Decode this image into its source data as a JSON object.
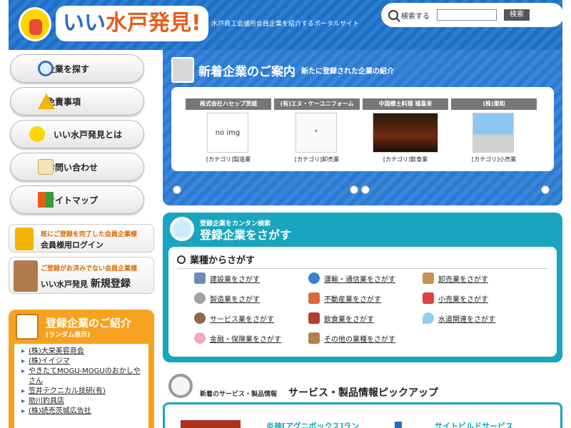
{
  "header": {
    "logo_main": "いい",
    "logo_accent": "水戸",
    "logo_end": "発見!",
    "tagline": "水戸商工会議所会員企業を紹介するポータルサイト",
    "search_label": "検索する",
    "search_value": "",
    "search_button": "検索"
  },
  "nav": {
    "items": [
      {
        "label": "企業を探す",
        "icon": "search-icon"
      },
      {
        "label": "免責事項",
        "icon": "warning-icon"
      },
      {
        "label": "いい水戸発見とは",
        "icon": "mascot-icon"
      },
      {
        "label": "お問い合わせ",
        "icon": "mail-icon"
      },
      {
        "label": "サイトマップ",
        "icon": "sitemap-icon"
      }
    ]
  },
  "member": {
    "login_small": "既にご登録を完了した会員企業様",
    "login_big": "会員様用ログイン",
    "register_small": "ご登録がお済みでない会員企業様",
    "register_brand": "いい水戸発見",
    "register_big": "新規登録"
  },
  "random": {
    "title": "登録企業のご紹介",
    "subtitle": "(ランダム表示)",
    "items": [
      "(株)大栄美容商会",
      "(株)イイジマ",
      "やきたてMOGU-MOGUのおかしやさん",
      "笠井テクニカル技研(有)",
      "助川釣具店",
      "(株)読売茨城広告社"
    ]
  },
  "new_companies": {
    "title": "新着企業のご案内",
    "subtitle": "新たに登録された企業の紹介",
    "cards": [
      {
        "name": "株式会社ハセップ茨城",
        "image": "no img",
        "category": "[カテゴリ]製造業"
      },
      {
        "name": "(有)エヌ・ケーユニフォーム",
        "image": "",
        "category": "[カテゴリ]卸売業"
      },
      {
        "name": "中国郷土料理 福喜来",
        "image": "",
        "category": "[カテゴリ]飲食業"
      },
      {
        "name": "(株)東和",
        "image": "",
        "category": "[カテゴリ]小売業"
      }
    ]
  },
  "industry": {
    "kicker": "登録企業をカンタン検索",
    "title": "登録企業をさがす",
    "section_title": "業種からさがす",
    "items": [
      {
        "label": "建設業をさがす",
        "icon": "construction-icon"
      },
      {
        "label": "運輸・通信業をさがす",
        "icon": "globe-icon"
      },
      {
        "label": "卸売業をさがす",
        "icon": "box-icon"
      },
      {
        "label": "製造業をさがす",
        "icon": "gear-icon"
      },
      {
        "label": "不動産業をさがす",
        "icon": "house-icon"
      },
      {
        "label": "小売業をさがす",
        "icon": "cart-icon"
      },
      {
        "label": "サービス業をさがす",
        "icon": "people-icon"
      },
      {
        "label": "飲食業をさがす",
        "icon": "cup-icon"
      },
      {
        "label": "水道関連をさがす",
        "icon": "water-drop-icon"
      },
      {
        "label": "金融・保険業をさがす",
        "icon": "piggy-bank-icon"
      },
      {
        "label": "その他の業種をさがす",
        "icon": "bag-icon"
      }
    ]
  },
  "pickup": {
    "kicker": "新着のサービス・製品情報",
    "title": "サービス・製品情報ピックアップ",
    "item_a": "炎神[アグニボックス]ラン",
    "item_b": "サイトビルドサービス"
  },
  "colors": {
    "header_blue": "#2a7fd3",
    "accent_orange": "#f7a21e",
    "teal": "#19a5c0"
  }
}
